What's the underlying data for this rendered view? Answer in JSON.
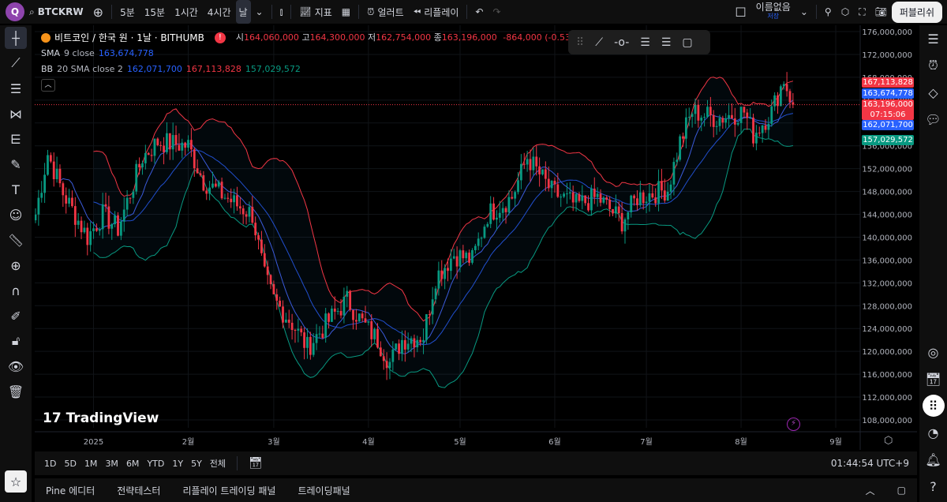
{
  "topbar": {
    "logo": "Q",
    "symbol": "BTCKRW",
    "intervals": [
      "5분",
      "15분",
      "1시간",
      "4시간",
      "날"
    ],
    "indicators": "지표",
    "alert": "얼러트",
    "replay": "리플레이",
    "layout_name": "이름없음",
    "save_status": "저장",
    "publish": "퍼블리쉬"
  },
  "legend": {
    "title": "비트코인 / 한국 원 · 1날 · BITHUMB",
    "o_label": "시",
    "o": "164,060,000",
    "h_label": "고",
    "h": "164,300,000",
    "l_label": "저",
    "l": "162,754,000",
    "c_label": "종",
    "c": "163,196,000",
    "change": "-864,000 (-0.53%)",
    "sma_label": "SMA",
    "sma_params": "9 close",
    "sma_value": "163,674,778",
    "bb_label": "BB",
    "bb_params": "20 SMA close 2",
    "bb_basis": "162,071,700",
    "bb_upper": "167,113,828",
    "bb_lower": "157,029,572"
  },
  "price_tags": {
    "upper": "167,113,828",
    "sma": "163,674,778",
    "last": "163,196,000",
    "countdown": "07:15:06",
    "basis": "162,071,700",
    "lower": "157,029,572"
  },
  "watermark": "TradingView",
  "range_buttons": [
    "1D",
    "5D",
    "1M",
    "3M",
    "6M",
    "YTD",
    "1Y",
    "5Y",
    "전체"
  ],
  "clock": "01:44:54 UTC+9",
  "bottom_tabs": [
    "Pine 에디터",
    "전략테스터",
    "리플레이 트레이딩 패널",
    "트레이딩패널"
  ],
  "colors": {
    "up": "#089981",
    "down": "#f23645",
    "sma": "#2962ff",
    "bb_upper": "#f23645",
    "bb_lower": "#089981",
    "bb_basis": "#2962ff"
  },
  "chart_data": {
    "type": "candlestick",
    "title": "BTCKRW 1D BITHUMB",
    "y_ticks": [
      176000000,
      172000000,
      168000000,
      164000000,
      160000000,
      156000000,
      152000000,
      148000000,
      144000000,
      140000000,
      136000000,
      132000000,
      128000000,
      124000000,
      120000000,
      116000000,
      112000000,
      108000000
    ],
    "y_tick_labels": [
      "176,000,000",
      "172,000,000",
      "168,000,000",
      "164,000,000",
      "160,000,000",
      "156,000,000",
      "152,000,000",
      "148,000,000",
      "144,000,000",
      "140,000,000",
      "136,000,000",
      "132,000,000",
      "128,000,000",
      "124,000,000",
      "120,000,000",
      "116,000,000",
      "112,000,000",
      "108,000,000"
    ],
    "ylim": [
      106000000,
      177200000
    ],
    "x_ticks": [
      {
        "day": 0,
        "label": "2025"
      },
      {
        "day": 31,
        "label": "2월"
      },
      {
        "day": 59,
        "label": "3월"
      },
      {
        "day": 90,
        "label": "4월"
      },
      {
        "day": 120,
        "label": "5월"
      },
      {
        "day": 151,
        "label": "6월"
      },
      {
        "day": 181,
        "label": "7월"
      },
      {
        "day": 212,
        "label": "8월"
      },
      {
        "day": 243,
        "label": "9월"
      }
    ],
    "x_range_days": [
      -19,
      251
    ],
    "close_keypoints_M": [
      [
        -19,
        144
      ],
      [
        -15,
        154.6
      ],
      [
        -10,
        147.7
      ],
      [
        -2,
        140
      ],
      [
        3,
        144
      ],
      [
        8,
        141.5
      ],
      [
        16,
        154
      ],
      [
        21,
        156.7
      ],
      [
        31,
        156
      ],
      [
        36,
        149.8
      ],
      [
        47,
        145.6
      ],
      [
        52,
        144
      ],
      [
        56,
        133
      ],
      [
        59,
        129
      ],
      [
        65,
        124.9
      ],
      [
        70,
        120.7
      ],
      [
        78,
        126
      ],
      [
        83,
        129
      ],
      [
        88,
        125
      ],
      [
        93,
        122
      ],
      [
        97,
        118
      ],
      [
        101,
        122
      ],
      [
        108,
        122.8
      ],
      [
        112,
        133
      ],
      [
        118,
        137
      ],
      [
        124,
        136
      ],
      [
        129,
        144
      ],
      [
        137,
        147
      ],
      [
        142,
        154
      ],
      [
        150,
        148
      ],
      [
        158,
        145.6
      ],
      [
        165,
        147
      ],
      [
        173,
        142.8
      ],
      [
        178,
        147
      ],
      [
        188,
        148.4
      ],
      [
        192,
        156.7
      ],
      [
        196,
        162
      ],
      [
        204,
        160.8
      ],
      [
        213,
        162
      ],
      [
        216,
        158
      ],
      [
        222,
        162
      ],
      [
        226,
        167.7
      ],
      [
        229,
        163.2
      ]
    ],
    "last_close": 163196000,
    "sma9": 163674778,
    "bb_basis": 162071700,
    "bb_upper": 167113828,
    "bb_lower": 157029572
  }
}
